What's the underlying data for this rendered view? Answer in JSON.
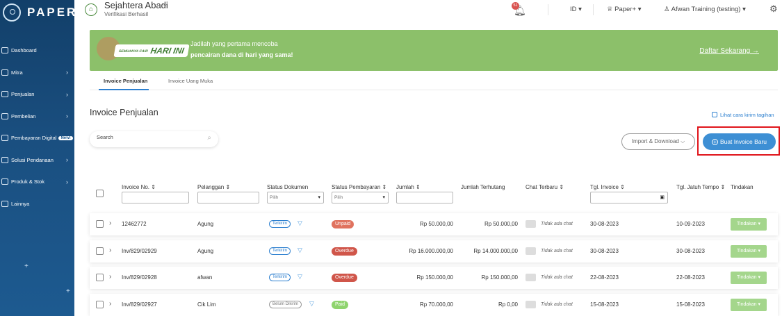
{
  "sidebar": {
    "logo_text": "PAPER",
    "items": [
      {
        "label": "Dashboard",
        "has_chevron": false
      },
      {
        "label": "Mitra",
        "has_chevron": true
      },
      {
        "label": "Penjualan",
        "has_chevron": true
      },
      {
        "label": "Pembelian",
        "has_chevron": true
      },
      {
        "label": "Pembayaran Digital",
        "badge": "New!",
        "has_chevron": true
      },
      {
        "label": "Solusi Pendanaan",
        "has_chevron": true
      },
      {
        "label": "Produk & Stok",
        "has_chevron": true
      },
      {
        "label": "Lainnya",
        "has_chevron": false
      }
    ],
    "chevron": "›"
  },
  "topbar": {
    "company_name": "Sejahtera Abadi",
    "company_status": "Verifikasi Berhasil",
    "notification_count": "51",
    "language": "ID ▾",
    "plan": "Paper+ ▾",
    "user": "Afwan Training (testing) ▾",
    "chevron": "⌵"
  },
  "banner": {
    "badge_small": "SEMUANYA CAIR",
    "badge_text": "HARI INI",
    "line1": "Jadilah yang pertama mencoba",
    "line2": "pencairan dana di hari yang sama!",
    "link": "Daftar Sekarang →"
  },
  "tabs": [
    {
      "label": "Invoice Penjualan",
      "active": true
    },
    {
      "label": "Invoice Uang Muka",
      "active": false
    }
  ],
  "page": {
    "title": "Invoice Penjualan",
    "help_link": "Lihat cara kirim tagihan",
    "search_placeholder": "Search",
    "import_button": "Import & Download ⌵",
    "create_button": "Buat Invoice Baru"
  },
  "table": {
    "headers": {
      "invoice_no": "Invoice No. ⇕",
      "pelanggan": "Pelanggan ⇕",
      "status_dokumen": "Status Dokumen",
      "status_pembayaran": "Status Pembayaran ⇕",
      "jumlah": "Jumlah ⇕",
      "jumlah_terhutang": "Jumlah Terhutang",
      "chat_terbaru": "Chat Terbaru ⇕",
      "tgl_invoice": "Tgl. Invoice ⇕",
      "tgl_jatuh_tempo": "Tgl. Jatuh Tempo ⇕",
      "tindakan": "Tindakan"
    },
    "filter_select_placeholder": "Pilih",
    "rows": [
      {
        "invoice_no": "12462772",
        "pelanggan": "Agung",
        "status_dokumen": "Terkirim",
        "status_pembayaran": "Unpaid",
        "jumlah": "Rp 50.000,00",
        "jumlah_terhutang": "Rp 50.000,00",
        "chat": "Tidak ada chat",
        "tgl_invoice": "30-08-2023",
        "tgl_jatuh_tempo": "10-09-2023",
        "tindakan": "Tindakan ▾"
      },
      {
        "invoice_no": "Inv/829/02929",
        "pelanggan": "Agung",
        "status_dokumen": "Terkirim",
        "status_pembayaran": "Overdue",
        "jumlah": "Rp 16.000.000,00",
        "jumlah_terhutang": "Rp 14.000.000,00",
        "chat": "Tidak ada chat",
        "tgl_invoice": "30-08-2023",
        "tgl_jatuh_tempo": "30-08-2023",
        "tindakan": "Tindakan ▾"
      },
      {
        "invoice_no": "Inv/829/02928",
        "pelanggan": "afwan",
        "status_dokumen": "Terkirim",
        "status_pembayaran": "Overdue",
        "jumlah": "Rp 150.000,00",
        "jumlah_terhutang": "Rp 150.000,00",
        "chat": "Tidak ada chat",
        "tgl_invoice": "22-08-2023",
        "tgl_jatuh_tempo": "22-08-2023",
        "tindakan": "Tindakan ▾"
      },
      {
        "invoice_no": "Inv/829/02927",
        "pelanggan": "Cik Lim",
        "status_dokumen": "Belum Dikirim",
        "status_pembayaran": "Paid",
        "jumlah": "Rp 70.000,00",
        "jumlah_terhutang": "Rp 0,00",
        "chat": "Tidak ada chat",
        "tgl_invoice": "15-08-2023",
        "tgl_jatuh_tempo": "15-08-2023",
        "tindakan": "Tindakan ▾"
      }
    ]
  },
  "colors": {
    "unpaid": "#e0725e",
    "overdue": "#d0564a",
    "paid": "#8fd46e",
    "primary": "#3d8fd4",
    "highlight": "#e0141a"
  }
}
